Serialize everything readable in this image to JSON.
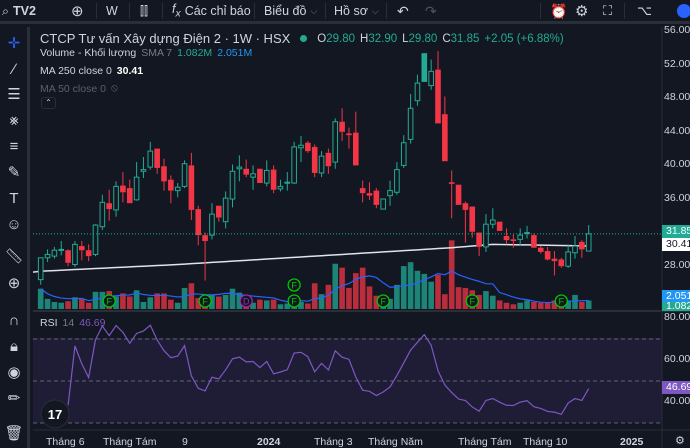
{
  "toolbar": {
    "symbol": "TV2",
    "interval": "W",
    "indicators": "Các chỉ báo",
    "chart_menu": "Biểu đồ",
    "profile_menu": "Hồ sơ"
  },
  "legend": {
    "title": "CTCP Tư vấn Xây dựng Điện 2 · 1W · HSX",
    "o_label": "O",
    "o": "29.80",
    "h_label": "H",
    "h": "32.90",
    "l_label": "L",
    "l": "29.80",
    "c_label": "C",
    "c": "31.85",
    "change": "+2.05 (+6.88%)",
    "volume_name": "Volume - Khối lượng",
    "volume_sma": "SMA 7",
    "volume_value": "1.082M",
    "volume_sma_value": "2.051M",
    "ma250": "MA 250 close 0",
    "ma250_value": "30.41",
    "ma50": "MA 50 close 0",
    "rsi_name": "RSI",
    "rsi_len": "14",
    "rsi_value": "46.69"
  },
  "price_axis": [
    "56.00",
    "52.00",
    "48.00",
    "44.00",
    "40.00",
    "36.00",
    "28.00"
  ],
  "price_tags": {
    "close": "31.85",
    "ma250": "30.41",
    "vol_sma": "2.051M",
    "vol": "1.082M",
    "rsi": "46.69"
  },
  "rsi_axis": [
    "80.00",
    "60.00",
    "40.00"
  ],
  "time_axis": [
    "Tháng 6",
    "Tháng Tám",
    "9",
    "2024",
    "Tháng 3",
    "Tháng Năm",
    "Tháng Tám",
    "Tháng 10",
    "2025"
  ],
  "colors": {
    "up": "#22ab94",
    "down": "#f23645",
    "ma250": "#e0e3eb",
    "vol_sma": "#2962ff",
    "rsi": "#7e57c2"
  },
  "chart_data": {
    "type": "candlestick",
    "ylim": [
      24,
      56
    ],
    "ohlc": [
      [
        26.4,
        27.5,
        25.8,
        29.0
      ],
      [
        29.0,
        30.0,
        28.5,
        29.4
      ],
      [
        29.2,
        30.3,
        28.9,
        29.9
      ],
      [
        29.9,
        31.0,
        29.3,
        30.0
      ],
      [
        29.9,
        30.0,
        28.0,
        28.4
      ],
      [
        28.2,
        31.0,
        27.9,
        30.6
      ],
      [
        30.4,
        31.0,
        28.7,
        29.9
      ],
      [
        29.9,
        30.6,
        28.6,
        29.2
      ],
      [
        29.4,
        33.0,
        29.2,
        32.9
      ],
      [
        32.7,
        36.5,
        32.3,
        35.6
      ],
      [
        35.5,
        37.1,
        33.4,
        34.8
      ],
      [
        34.7,
        38.1,
        33.9,
        37.5
      ],
      [
        37.6,
        39.2,
        35.6,
        36.8
      ],
      [
        37.3,
        38.3,
        35.5,
        35.5
      ],
      [
        35.9,
        40.4,
        35.8,
        38.6
      ],
      [
        39.3,
        41.0,
        38.5,
        39.5
      ],
      [
        39.8,
        42.8,
        39.5,
        41.7
      ],
      [
        42.0,
        42.0,
        39.0,
        39.7
      ],
      [
        39.9,
        40.8,
        37.0,
        38.1
      ],
      [
        38.3,
        38.8,
        35.5,
        37.0
      ],
      [
        37.0,
        37.9,
        36.2,
        37.4
      ],
      [
        37.5,
        40.6,
        37.3,
        40.2
      ],
      [
        40.0,
        41.5,
        33.5,
        34.7
      ],
      [
        34.8,
        35.2,
        30.5,
        31.7
      ],
      [
        31.7,
        32.0,
        26.3,
        31.0
      ],
      [
        31.7,
        35.5,
        31.2,
        34.2
      ],
      [
        35.2,
        35.2,
        33.3,
        33.8
      ],
      [
        33.3,
        36.9,
        32.5,
        36.1
      ],
      [
        36.0,
        40.1,
        35.0,
        39.3
      ],
      [
        39.6,
        41.2,
        38.1,
        39.8
      ],
      [
        39.6,
        40.7,
        38.6,
        38.9
      ],
      [
        38.6,
        40.0,
        37.1,
        39.0
      ],
      [
        39.6,
        39.6,
        37.9,
        37.9
      ],
      [
        37.9,
        40.6,
        37.5,
        39.4
      ],
      [
        39.5,
        40.0,
        36.7,
        37.1
      ],
      [
        37.2,
        38.3,
        36.9,
        37.5
      ],
      [
        38.0,
        39.2,
        37.0,
        38.0
      ],
      [
        37.9,
        42.8,
        37.8,
        42.2
      ],
      [
        42.1,
        43.5,
        40.4,
        42.4
      ],
      [
        42.7,
        42.9,
        41.5,
        41.7
      ],
      [
        42.2,
        42.5,
        38.6,
        39.1
      ],
      [
        39.1,
        41.7,
        38.6,
        41.1
      ],
      [
        41.5,
        42.0,
        39.0,
        39.9
      ],
      [
        40.4,
        45.6,
        39.6,
        45.2
      ],
      [
        45.2,
        46.8,
        42.9,
        44.0
      ],
      [
        43.8,
        44.5,
        42.0,
        43.6
      ],
      [
        43.9,
        46.4,
        40.0,
        40.0
      ],
      [
        37.3,
        38.2,
        35.6,
        36.7
      ],
      [
        36.7,
        38.0,
        35.9,
        36.4
      ],
      [
        37.0,
        37.3,
        34.9,
        35.3
      ],
      [
        34.8,
        36.0,
        34.8,
        36.0
      ],
      [
        36.4,
        38.2,
        35.2,
        37.0
      ],
      [
        36.8,
        40.4,
        36.5,
        39.5
      ],
      [
        40.0,
        43.6,
        39.7,
        42.7
      ],
      [
        43.1,
        48.5,
        42.6,
        46.8
      ],
      [
        47.7,
        50.8,
        47.1,
        49.8
      ],
      [
        50.0,
        53.3,
        50.0,
        53.3
      ],
      [
        49.5,
        52.6,
        49.0,
        51.2
      ],
      [
        51.4,
        53.6,
        45.0,
        45.0
      ],
      [
        46.1,
        48.2,
        40.5,
        40.5
      ],
      [
        38.0,
        39.4,
        33.7,
        37.8
      ],
      [
        37.7,
        37.7,
        35.3,
        35.3
      ],
      [
        35.5,
        35.7,
        30.8,
        34.7
      ],
      [
        35.1,
        35.1,
        31.4,
        32.1
      ],
      [
        32.0,
        32.0,
        29.2,
        30.3
      ],
      [
        30.3,
        34.2,
        29.7,
        33.0
      ],
      [
        33.0,
        34.9,
        32.5,
        33.5
      ],
      [
        33.3,
        33.3,
        32.2,
        32.2
      ],
      [
        31.6,
        32.5,
        30.6,
        31.1
      ],
      [
        31.2,
        31.8,
        30.2,
        31.0
      ],
      [
        31.2,
        32.5,
        30.4,
        31.7
      ],
      [
        31.9,
        32.8,
        31.3,
        32.0
      ],
      [
        31.7,
        31.9,
        30.2,
        30.2
      ],
      [
        30.2,
        30.4,
        29.5,
        29.7
      ],
      [
        29.8,
        30.3,
        28.7,
        28.8
      ],
      [
        28.9,
        29.8,
        26.9,
        28.6
      ],
      [
        28.8,
        29.0,
        27.8,
        28.0
      ],
      [
        28.0,
        30.6,
        27.8,
        29.7
      ],
      [
        29.6,
        31.6,
        28.9,
        30.4
      ],
      [
        30.9,
        31.1,
        29.0,
        30.0
      ],
      [
        29.8,
        32.9,
        29.8,
        31.85
      ]
    ],
    "volume_m": [
      2.6,
      1.3,
      0.9,
      0.8,
      1.0,
      1.5,
      1.3,
      0.8,
      2.2,
      2.2,
      2.3,
      1.6,
      2.0,
      1.6,
      2.4,
      0.9,
      1.5,
      2.0,
      2.0,
      1.2,
      0.8,
      2.7,
      3.3,
      1.4,
      1.5,
      1.8,
      1.6,
      1.8,
      2.6,
      2.1,
      0.9,
      0.8,
      1.2,
      1.1,
      1.2,
      0.6,
      0.7,
      1.8,
      0.9,
      0.7,
      3.3,
      1.9,
      3.1,
      5.8,
      5.3,
      2.7,
      4.6,
      5.3,
      2.9,
      1.7,
      1.0,
      1.3,
      3.1,
      5.5,
      6.0,
      4.9,
      4.5,
      3.5,
      4.4,
      1.9,
      8.8,
      2.8,
      2.7,
      2.4,
      1.8,
      2.3,
      1.7,
      1.1,
      0.8,
      0.6,
      0.8,
      1.1,
      0.9,
      0.8,
      0.8,
      1.1,
      0.9,
      1.1,
      1.8,
      0.9,
      1.082
    ],
    "ma250_anchors": [
      [
        0,
        27.4
      ],
      [
        20,
        28.2
      ],
      [
        40,
        29.2
      ],
      [
        60,
        30.2
      ],
      [
        66,
        30.6
      ],
      [
        80,
        30.41
      ]
    ],
    "events": [
      {
        "index": 10,
        "label": "F"
      },
      {
        "index": 24,
        "label": "F"
      },
      {
        "index": 30,
        "label": "D"
      },
      {
        "index": 37,
        "label": "F"
      },
      {
        "index": 37,
        "label": "F",
        "stack": 1
      },
      {
        "index": 50,
        "label": "F"
      },
      {
        "index": 63,
        "label": "F"
      },
      {
        "index": 76,
        "label": "F"
      }
    ],
    "rsi_ylim": [
      20,
      80
    ],
    "rsi_levels": [
      70,
      50,
      30
    ]
  }
}
